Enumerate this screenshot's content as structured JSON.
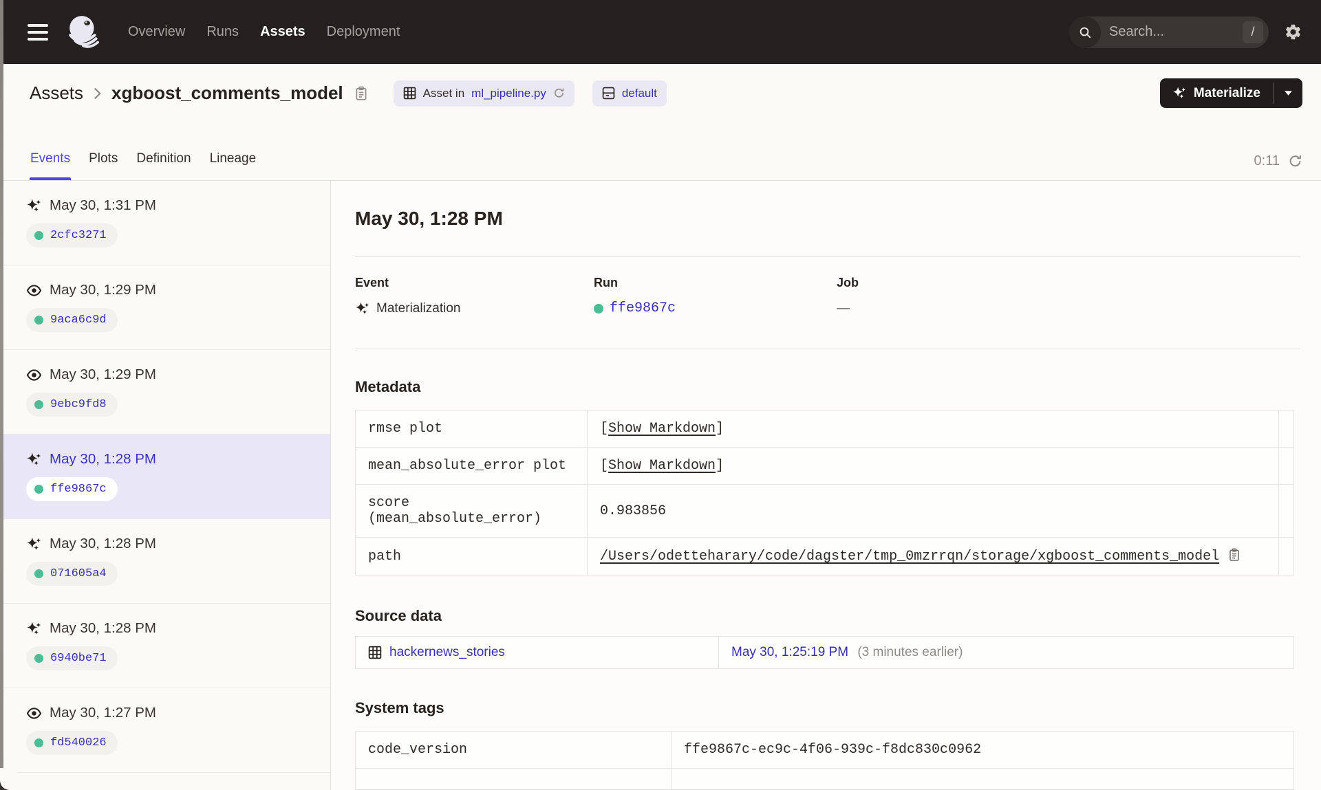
{
  "nav": {
    "items": [
      {
        "label": "Overview",
        "active": false
      },
      {
        "label": "Runs",
        "active": false
      },
      {
        "label": "Assets",
        "active": true
      },
      {
        "label": "Deployment",
        "active": false
      }
    ],
    "search_placeholder": "Search...",
    "search_shortcut": "/"
  },
  "header": {
    "breadcrumb_root": "Assets",
    "asset_name": "xgboost_comments_model",
    "asset_badge": {
      "prefix": "Asset in",
      "link": "ml_pipeline.py"
    },
    "group_badge": "default",
    "materialize_label": "Materialize"
  },
  "tabs": {
    "items": [
      {
        "label": "Events",
        "active": true
      },
      {
        "label": "Plots",
        "active": false
      },
      {
        "label": "Definition",
        "active": false
      },
      {
        "label": "Lineage",
        "active": false
      }
    ],
    "timer": "0:11"
  },
  "sidebar": {
    "events": [
      {
        "type": "materialization",
        "timestamp": "May 30, 1:31 PM",
        "run_id": "2cfc3271",
        "selected": false
      },
      {
        "type": "observation",
        "timestamp": "May 30, 1:29 PM",
        "run_id": "9aca6c9d",
        "selected": false
      },
      {
        "type": "observation",
        "timestamp": "May 30, 1:29 PM",
        "run_id": "9ebc9fd8",
        "selected": false
      },
      {
        "type": "materialization",
        "timestamp": "May 30, 1:28 PM",
        "run_id": "ffe9867c",
        "selected": true
      },
      {
        "type": "materialization",
        "timestamp": "May 30, 1:28 PM",
        "run_id": "071605a4",
        "selected": false
      },
      {
        "type": "materialization",
        "timestamp": "May 30, 1:28 PM",
        "run_id": "6940be71",
        "selected": false
      },
      {
        "type": "observation",
        "timestamp": "May 30, 1:27 PM",
        "run_id": "fd540026",
        "selected": false
      }
    ]
  },
  "detail": {
    "title": "May 30, 1:28 PM",
    "event_label": "Event",
    "event_value": "Materialization",
    "run_label": "Run",
    "run_value": "ffe9867c",
    "job_label": "Job",
    "job_value": "—",
    "metadata": {
      "heading": "Metadata",
      "rows": [
        {
          "key": "rmse plot",
          "kind": "markdown",
          "bracket_open": "[",
          "link_text": "Show Markdown",
          "bracket_close": "]"
        },
        {
          "key": "mean_absolute_error plot",
          "kind": "markdown",
          "bracket_open": "[",
          "link_text": "Show Markdown",
          "bracket_close": "]"
        },
        {
          "key": "score (mean_absolute_error)",
          "kind": "text",
          "value": "0.983856"
        },
        {
          "key": "path",
          "kind": "path",
          "value": "/Users/odetteharary/code/dagster/tmp_0mzrrqn/storage/xgboost_comments_model"
        }
      ]
    },
    "source_data": {
      "heading": "Source data",
      "asset": "hackernews_stories",
      "timestamp": "May 30, 1:25:19 PM",
      "relative": "(3 minutes earlier)"
    },
    "system_tags": {
      "heading": "System tags",
      "rows": [
        {
          "key": "code_version",
          "value": "ffe9867c-ec9c-4f06-939c-f8dc830c0962"
        }
      ]
    }
  },
  "colors": {
    "nav_bg": "#242020",
    "accent": "#4F43DD",
    "link": "#362FB0",
    "success_green": "#4BBD96",
    "selected_row_bg": "#E8E6F7",
    "badge_bg": "#EAE8F2",
    "button_bg": "#201D1C"
  }
}
